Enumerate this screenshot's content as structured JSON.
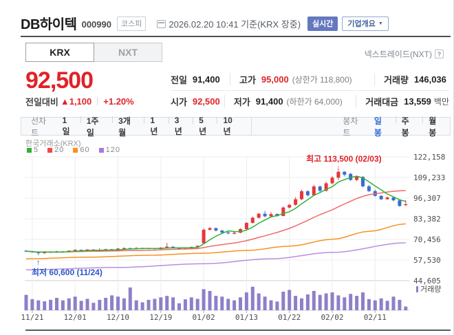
{
  "header": {
    "title": "DB하이텍",
    "code": "000990",
    "market_badge": "코스피",
    "datetime": "2026.02.20 10:41  기준(KRX 장중)",
    "realtime_badge": "실시간",
    "overview_label": "기업개요",
    "caret": "▼"
  },
  "tabs": {
    "krx": "KRX",
    "nxt": "NXT",
    "right_link": "넥스트레이드(NXT)",
    "help": "?"
  },
  "price": {
    "current": "92,500",
    "change_label": "전일대비",
    "change_arrow": "▲",
    "change_value": "1,100",
    "change_percent": "+1.20%",
    "details": {
      "rows": [
        {
          "cells": [
            {
              "name": "prev-close",
              "label": "전일",
              "value": "91,400",
              "red": false
            },
            {
              "name": "day-high",
              "label": "고가",
              "value": "95,000",
              "red": true,
              "extra": "(상한가 118,800)"
            },
            {
              "name": "volume",
              "label": "거래량",
              "value": "146,036",
              "red": false
            }
          ]
        },
        {
          "cells": [
            {
              "name": "open",
              "label": "시가",
              "value": "92,500",
              "red": true
            },
            {
              "name": "day-low",
              "label": "저가",
              "value": "91,400",
              "red": false,
              "extra": "(하한가 64,000)"
            },
            {
              "name": "trade-amount",
              "label": "거래대금",
              "value": "13,559",
              "red": false,
              "unit": "백만"
            }
          ]
        }
      ]
    }
  },
  "toolbar": {
    "line_label": "선차트",
    "line_items": [
      "1일",
      "1주일",
      "3개월",
      "1년",
      "3년",
      "5년",
      "10년"
    ],
    "candle_label": "봉차트",
    "candle_items": [
      "일봉",
      "주봉",
      "월봉"
    ],
    "selected": "일봉"
  },
  "chart_data": {
    "type": "candlestick",
    "title": "한국거래소(KRX)",
    "legend": [
      {
        "label": "5",
        "color": "#2eb135"
      },
      {
        "label": "20",
        "color": "#ee4a4a"
      },
      {
        "label": "60",
        "color": "#f6921e"
      },
      {
        "label": "120",
        "color": "#a87ae0"
      }
    ],
    "y_ticks": [
      "122,158",
      "109,233",
      "96,307",
      "83,382",
      "70,456",
      "57,530",
      "44,605"
    ],
    "y_range": [
      44605,
      122158
    ],
    "x_ticks": [
      "11/21",
      "12/01",
      "12/10",
      "12/19",
      "01/02",
      "01/13",
      "01/22",
      "02/02",
      "02/11"
    ],
    "x_tick_indices": [
      1,
      8,
      15,
      22,
      29,
      36,
      43,
      50,
      57
    ],
    "volume_label": "거래량",
    "annotations": {
      "high": {
        "text": "최고 113,500 (02/03)",
        "index": 51,
        "price": 113500,
        "arrow": "↓"
      },
      "low": {
        "text": "최저 60,600 (11/24)",
        "index": 2,
        "price": 60600,
        "arrow": "↑"
      }
    },
    "colors": {
      "up": "#e8363b",
      "down": "#3a6cd0",
      "ma5": "#2eb135",
      "ma20": "#ee6a6a",
      "ma60": "#f6921e",
      "ma120": "#b78ee0",
      "volume": "#8f7fc8",
      "grid": "#ececec",
      "axis_text": "#4b4b4b",
      "frame": "#cfcfcf",
      "high_text": "#e12228",
      "low_text": "#2f55c8"
    },
    "candles": [
      [
        63400,
        63700,
        62600,
        63000,
        62
      ],
      [
        63000,
        63300,
        62100,
        62600,
        45
      ],
      [
        62600,
        62800,
        60600,
        61800,
        40
      ],
      [
        61800,
        63100,
        61500,
        62900,
        36
      ],
      [
        62800,
        63000,
        61900,
        62200,
        42
      ],
      [
        62200,
        63300,
        62000,
        63000,
        50
      ],
      [
        63000,
        63200,
        62200,
        62500,
        40
      ],
      [
        62500,
        63600,
        62300,
        63400,
        48
      ],
      [
        63400,
        64300,
        63100,
        63900,
        55
      ],
      [
        63900,
        64100,
        62900,
        63300,
        38
      ],
      [
        63300,
        64400,
        63100,
        64100,
        46
      ],
      [
        64100,
        64300,
        63300,
        63600,
        30
      ],
      [
        63700,
        64900,
        63100,
        63300,
        42
      ],
      [
        63300,
        64600,
        63200,
        64300,
        50
      ],
      [
        64300,
        64500,
        63400,
        63700,
        60
      ],
      [
        63700,
        65000,
        63500,
        64700,
        55
      ],
      [
        64700,
        65400,
        64400,
        65000,
        48
      ],
      [
        65000,
        65200,
        64100,
        64400,
        92
      ],
      [
        64400,
        65500,
        64200,
        65100,
        40
      ],
      [
        65100,
        65300,
        64200,
        64500,
        32
      ],
      [
        64500,
        65200,
        64300,
        65000,
        42
      ],
      [
        65000,
        65100,
        64100,
        64400,
        46
      ],
      [
        64400,
        65600,
        64200,
        65300,
        52
      ],
      [
        65300,
        68200,
        65100,
        65900,
        58
      ],
      [
        65900,
        66100,
        64900,
        65200,
        52
      ],
      [
        65200,
        65400,
        64400,
        64700,
        28
      ],
      [
        64600,
        65300,
        64300,
        64800,
        44
      ],
      [
        64800,
        66000,
        64600,
        65700,
        52
      ],
      [
        65700,
        66700,
        65400,
        66400,
        46
      ],
      [
        68000,
        77200,
        67600,
        76500,
        85
      ],
      [
        76500,
        78200,
        75900,
        77500,
        78
      ],
      [
        77500,
        77900,
        75400,
        76000,
        58
      ],
      [
        76000,
        76400,
        74100,
        74700,
        55
      ],
      [
        74800,
        75500,
        73700,
        74300,
        46
      ],
      [
        74300,
        75600,
        73600,
        74600,
        40
      ],
      [
        74600,
        77400,
        74300,
        76900,
        52
      ],
      [
        76900,
        81300,
        76500,
        80800,
        72
      ],
      [
        80800,
        84700,
        80400,
        84000,
        95
      ],
      [
        84000,
        87100,
        83600,
        86500,
        68
      ],
      [
        86500,
        88300,
        84300,
        84900,
        55
      ],
      [
        84900,
        87600,
        84400,
        86300,
        40
      ],
      [
        86300,
        86900,
        84600,
        85100,
        35
      ],
      [
        85100,
        91100,
        84900,
        90400,
        75
      ],
      [
        90400,
        92600,
        89800,
        92100,
        82
      ],
      [
        92100,
        96900,
        91600,
        95600,
        58
      ],
      [
        95600,
        101600,
        95100,
        100600,
        48
      ],
      [
        100600,
        101200,
        97300,
        98100,
        64
      ],
      [
        98100,
        104600,
        97700,
        103600,
        78
      ],
      [
        103600,
        104200,
        99900,
        100900,
        62
      ],
      [
        100900,
        106600,
        100400,
        105600,
        68
      ],
      [
        105600,
        110100,
        104900,
        109100,
        72
      ],
      [
        109100,
        113500,
        107600,
        112800,
        60
      ],
      [
        112800,
        113300,
        109900,
        111000,
        52
      ],
      [
        111500,
        112100,
        107100,
        107700,
        66
      ],
      [
        107700,
        110400,
        106900,
        109600,
        58
      ],
      [
        109600,
        110100,
        103100,
        103700,
        72
      ],
      [
        103700,
        104600,
        100100,
        100700,
        45
      ],
      [
        100700,
        101600,
        97200,
        97700,
        40
      ],
      [
        97700,
        98200,
        95100,
        95600,
        48
      ],
      [
        95600,
        97300,
        95300,
        96700,
        38
      ],
      [
        96700,
        96900,
        94400,
        94900,
        55
      ],
      [
        94900,
        95300,
        90900,
        91400,
        42
      ],
      [
        92450,
        95000,
        91400,
        92500,
        15
      ]
    ],
    "ma60_points": [
      [
        0,
        58300
      ],
      [
        10,
        59300
      ],
      [
        20,
        60500
      ],
      [
        29,
        61800
      ],
      [
        36,
        63500
      ],
      [
        43,
        66200
      ],
      [
        50,
        70500
      ],
      [
        56,
        75500
      ],
      [
        62,
        80200
      ]
    ],
    "ma120_points": [
      [
        0,
        51400
      ],
      [
        15,
        52900
      ],
      [
        29,
        55200
      ],
      [
        40,
        58300
      ],
      [
        50,
        62300
      ],
      [
        62,
        68300
      ]
    ]
  }
}
